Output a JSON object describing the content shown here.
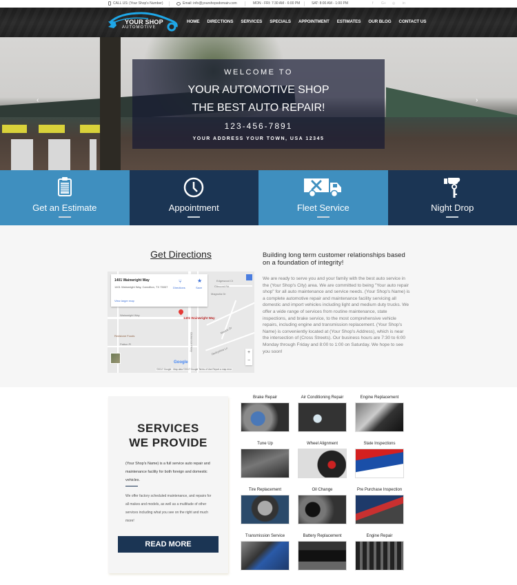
{
  "topbar": {
    "phone": "CALL US: (Your Shop's Number)",
    "email": "Email: info@yourshopsdomain.com",
    "hours_weekday": "MON - FRI: 7:30 AM - 6:00 PM",
    "hours_saturday": "SAT: 8:00 AM - 1:00 PM",
    "social": [
      "f",
      "G+",
      "◎",
      "in"
    ]
  },
  "header": {
    "logo_line1": "YOUR SHOP",
    "logo_line2": "AUTOMOTIVE",
    "nav": [
      "HOME",
      "DIRECTIONS",
      "SERVICES",
      "SPECIALS",
      "APPOINTMENT",
      "ESTIMATES",
      "OUR BLOG",
      "CONTACT US"
    ]
  },
  "hero": {
    "welcome": "WELCOME TO",
    "line1": "YOUR AUTOMOTIVE SHOP",
    "line2": "THE BEST AUTO REPAIR!",
    "phone": "123-456-7891",
    "address": "YOUR ADDRESS YOUR TOWN, USA 12345",
    "prev_arrow": "‹",
    "next_arrow": "›"
  },
  "tiles": [
    {
      "label": "Get an Estimate",
      "icon": "clipboard-icon"
    },
    {
      "label": "Appointment",
      "icon": "clock-icon"
    },
    {
      "label": "Fleet Service",
      "icon": "truck-icon"
    },
    {
      "label": "Night Drop",
      "icon": "key-drop-icon"
    }
  ],
  "directions": {
    "title": "Get Directions",
    "map": {
      "place_name": "1401 Wainwright Way",
      "place_address": "1401 Wainwright Way, Carrollton, TX 75007",
      "view_larger": "View larger map",
      "directions_label": "Directions",
      "save_label": "Save",
      "pin_label": "1401 Wainwright Way",
      "streets": [
        "Wainwright Way",
        "Redstone Foods",
        "Patton Pl",
        "Edgewood Ct",
        "Mackie Dr",
        "Derbyshire Ln",
        "Dickerson Pkwy",
        "Magnolia Dr",
        "Concord Rd"
      ],
      "zoom_in": "+",
      "zoom_out": "−",
      "google": "Google",
      "footer": "©2017 Google · Map data ©2017 Google   Terms of Use   Report a map error"
    }
  },
  "about": {
    "heading": "Building long term customer relationships based on a foundation of integrity!",
    "body": "We are ready to serve you and your family with the best auto service in the (Your Shop's City) area. We are committed to being \"Your auto repair shop\" for all auto maintenance and service needs. (Your Shop's Name) is a complete automotive repair and maintenance facility servicing all domestic and import vehicles including light and medium duty trucks. We offer a wide range of services from routine maintenance, state inspections, and brake service, to the most comprehensive vehicle repairs, including engine and transmission replacement. (Your Shop's Name) is conveniently located at (Your Shop's Address), which is near the intersection of (Cross Streets). Our business hours are 7:30 to 6:00 Monday through Friday and 8:00 to 1:00 on Saturday. We hope to see you soon!"
  },
  "services": {
    "title_line1": "SERVICES",
    "title_line2": "WE PROVIDE",
    "intro": "(Your Shop's Name) is a full service auto repair and maintenance facility for both foreign and domestic vehicles.",
    "detail": "We offer factory scheduled maintenance, and repairs for all makes and models, as well as a multitude of other services including what you see on the right and much more!",
    "read_more": "READ MORE",
    "items": [
      {
        "name": "Brake Repair"
      },
      {
        "name": "Air Conditioning Repair"
      },
      {
        "name": "Engine Replacement"
      },
      {
        "name": "Tune Up"
      },
      {
        "name": "Wheel Alignment"
      },
      {
        "name": "State Inspections"
      },
      {
        "name": "Tire Replacement"
      },
      {
        "name": "Oil Change"
      },
      {
        "name": "Pre Purchase Inspection"
      },
      {
        "name": "Transmission Service"
      },
      {
        "name": "Battery Replacement"
      },
      {
        "name": "Engine Repair"
      }
    ]
  },
  "colors": {
    "tile_light": "#3f8fbf",
    "tile_dark": "#1b3554",
    "logo_blue": "#1ea7e8",
    "button": "#1b3554"
  }
}
